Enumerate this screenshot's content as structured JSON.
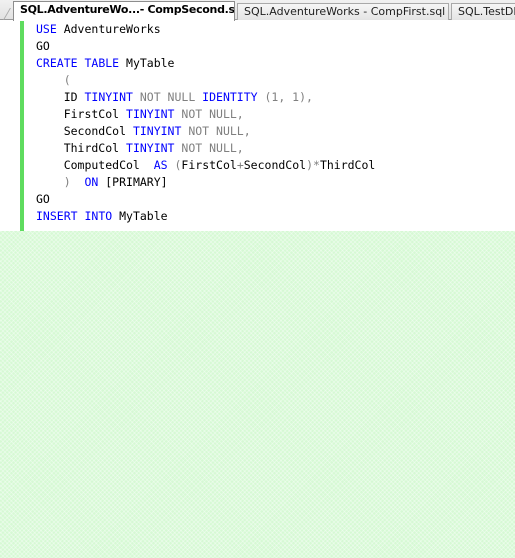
{
  "tabs": [
    {
      "label": "SQL.AdventureWo...- CompSecond.sql",
      "active": true
    },
    {
      "label": "SQL.AdventureWorks - CompFirst.sql",
      "active": false
    },
    {
      "label": "SQL.TestDB",
      "active": false
    }
  ],
  "editor": {
    "change_bar_color": "#5fdc5f",
    "lines": [
      [
        {
          "t": "USE ",
          "c": "kw"
        },
        {
          "t": "AdventureWorks",
          "c": "tx"
        }
      ],
      [
        {
          "t": "GO",
          "c": "tx"
        }
      ],
      [
        {
          "t": "CREATE ",
          "c": "kw"
        },
        {
          "t": "TABLE ",
          "c": "kw"
        },
        {
          "t": "MyTable",
          "c": "tx"
        }
      ],
      [
        {
          "t": "    (",
          "c": "gr"
        }
      ],
      [
        {
          "t": "    ID ",
          "c": "tx"
        },
        {
          "t": "TINYINT ",
          "c": "kw"
        },
        {
          "t": "NOT NULL ",
          "c": "gr"
        },
        {
          "t": "IDENTITY ",
          "c": "kw"
        },
        {
          "t": "(1, 1),",
          "c": "gr"
        }
      ],
      [
        {
          "t": "    FirstCol ",
          "c": "tx"
        },
        {
          "t": "TINYINT ",
          "c": "kw"
        },
        {
          "t": "NOT NULL,",
          "c": "gr"
        }
      ],
      [
        {
          "t": "    SecondCol ",
          "c": "tx"
        },
        {
          "t": "TINYINT ",
          "c": "kw"
        },
        {
          "t": "NOT NULL,",
          "c": "gr"
        }
      ],
      [
        {
          "t": "    ThirdCol ",
          "c": "tx"
        },
        {
          "t": "TINYINT ",
          "c": "kw"
        },
        {
          "t": "NOT NULL,",
          "c": "gr"
        }
      ],
      [
        {
          "t": "    ComputedCol  ",
          "c": "tx"
        },
        {
          "t": "AS ",
          "c": "kw"
        },
        {
          "t": "(",
          "c": "gr"
        },
        {
          "t": "FirstCol",
          "c": "tx"
        },
        {
          "t": "+",
          "c": "gr"
        },
        {
          "t": "SecondCol",
          "c": "tx"
        },
        {
          "t": ")",
          "c": "gr"
        },
        {
          "t": "*",
          "c": "gr"
        },
        {
          "t": "ThirdCol",
          "c": "tx"
        }
      ],
      [
        {
          "t": "    )  ",
          "c": "gr"
        },
        {
          "t": "ON ",
          "c": "kw"
        },
        {
          "t": "[PRIMARY]",
          "c": "tx"
        }
      ],
      [
        {
          "t": "GO",
          "c": "tx"
        }
      ],
      [
        {
          "t": "INSERT ",
          "c": "kw"
        },
        {
          "t": "INTO ",
          "c": "kw"
        },
        {
          "t": "MyTable",
          "c": "tx"
        }
      ]
    ]
  },
  "colors": {
    "keyword": "#0000ff",
    "operator": "#808080",
    "text": "#000000",
    "empty_area": "#d6f9d4"
  }
}
